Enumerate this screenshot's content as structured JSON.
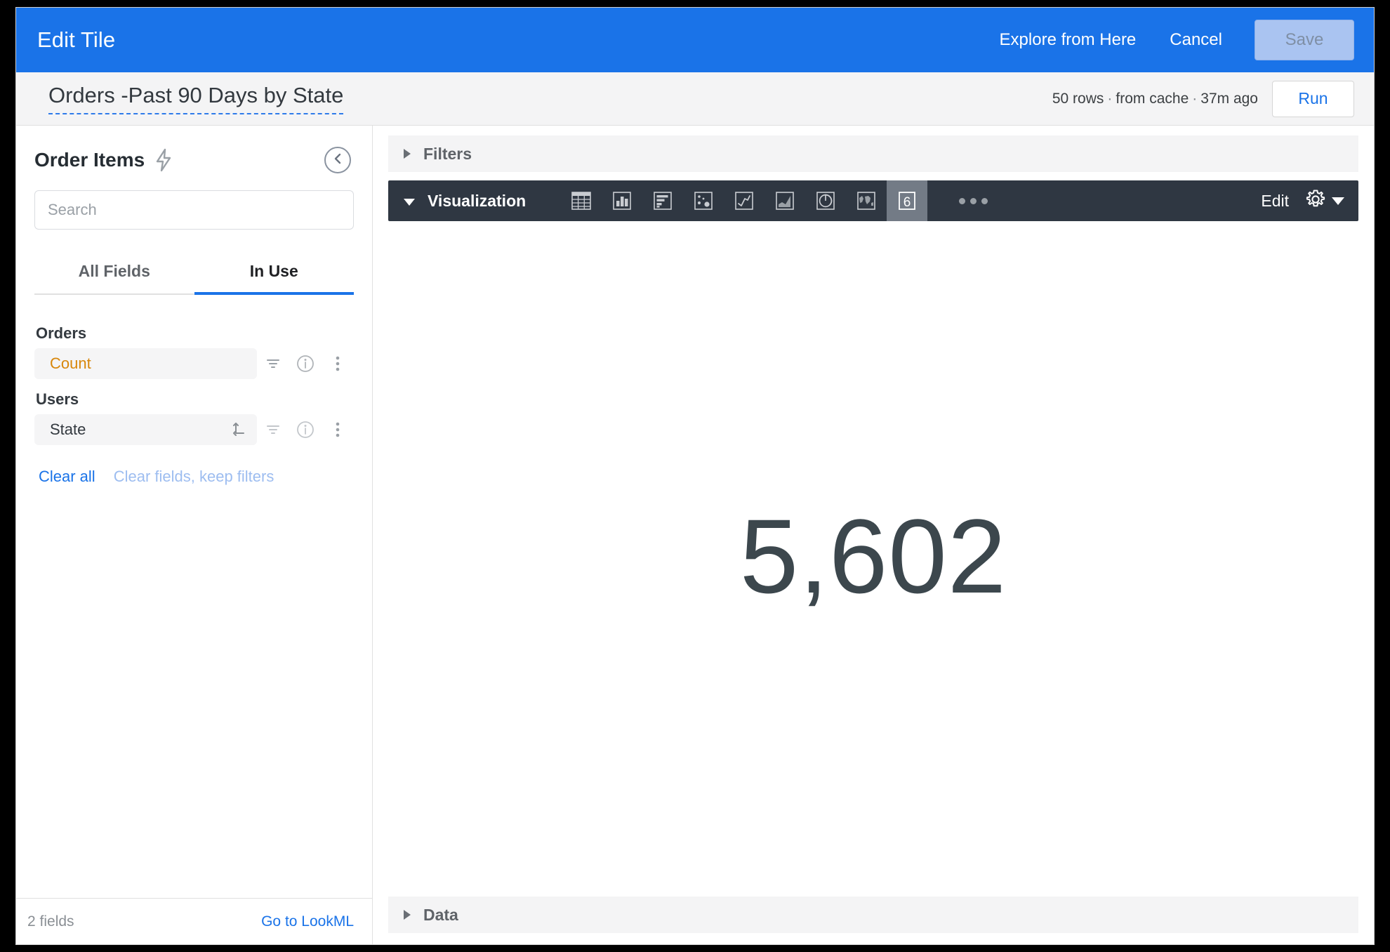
{
  "window": {
    "header": {
      "title": "Edit Tile",
      "explore_label": "Explore from Here",
      "cancel_label": "Cancel",
      "save_label": "Save",
      "accent_color": "#1a73e8",
      "save_disabled_bg": "#aac4f1"
    },
    "subheader": {
      "tile_title": "Orders -Past 90 Days by State",
      "row_count": "50 rows",
      "separator": "·",
      "cache_status": "from cache",
      "age": "37m ago",
      "run_label": "Run"
    }
  },
  "sidebar": {
    "explore_name": "Order Items",
    "lightning_icon": "lightning-bolt-icon",
    "collapse_icon": "chevron-left-circle-icon",
    "search": {
      "value": "",
      "placeholder": "Search"
    },
    "tabs": [
      {
        "label": "All Fields",
        "active": false
      },
      {
        "label": "In Use",
        "active": true
      }
    ],
    "groups": [
      {
        "label": "Orders",
        "fields": [
          {
            "name": "Count",
            "type": "measure",
            "has_pivot_icon": false,
            "icons": [
              "filter-icon",
              "info-icon",
              "overflow-menu-icon"
            ]
          }
        ]
      },
      {
        "label": "Users",
        "fields": [
          {
            "name": "State",
            "type": "dimension",
            "has_pivot_icon": true,
            "icons": [
              "pivot-icon",
              "filter-icon",
              "info-icon",
              "overflow-menu-icon"
            ]
          }
        ]
      }
    ],
    "clear_all_label": "Clear all",
    "clear_keep_label": "Clear fields, keep filters",
    "footer": {
      "field_count": "2 fields",
      "lookml_label": "Go to LookML"
    }
  },
  "main": {
    "filters_section": {
      "label": "Filters",
      "expanded": false
    },
    "visualization_section": {
      "label": "Visualization",
      "expanded": true,
      "edit_label": "Edit",
      "settings_icon": "gear-icon",
      "overflow_icon": "more-horizontal-icon",
      "chart_types": [
        {
          "name": "table-chart-icon",
          "selected": false
        },
        {
          "name": "column-chart-icon",
          "selected": false
        },
        {
          "name": "bar-chart-icon",
          "selected": false
        },
        {
          "name": "scatter-chart-icon",
          "selected": false
        },
        {
          "name": "line-chart-icon",
          "selected": false
        },
        {
          "name": "area-chart-icon",
          "selected": false
        },
        {
          "name": "pie-chart-icon",
          "selected": false
        },
        {
          "name": "map-chart-icon",
          "selected": false
        },
        {
          "name": "single-value-icon",
          "label": "6",
          "selected": true
        }
      ]
    },
    "data_section": {
      "label": "Data",
      "expanded": false
    }
  },
  "chart_data": {
    "type": "single_value",
    "title": "Orders -Past 90 Days by State",
    "value_label": "5,602",
    "value": 5602,
    "measure": "Orders Count",
    "dimension": "Users State",
    "row_count": 50,
    "categories": [],
    "values": [
      5602
    ]
  }
}
